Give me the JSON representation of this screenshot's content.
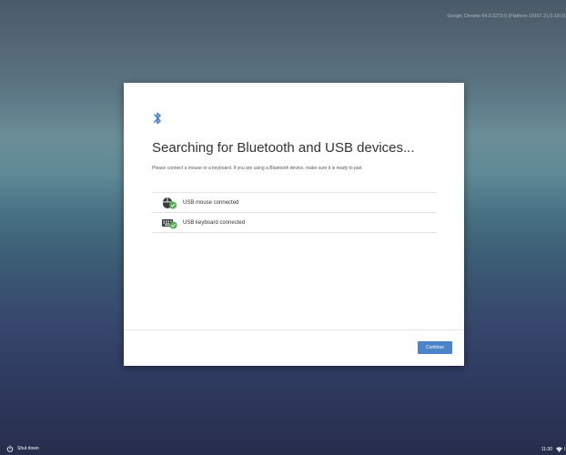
{
  "system": {
    "version": "Google Chrome 64.0.3273.0 (Platform 10167.21.0-18.01"
  },
  "dialog": {
    "icon": "bluetooth-icon",
    "title": "Searching for Bluetooth and USB devices...",
    "subtitle": "Please connect a mouse or a keyboard. If you are using a Bluetooth device, make sure it is ready to pair.",
    "devices": [
      {
        "label": "USB mouse connected",
        "icon": "mouse-icon",
        "status_icon": "check-circle-icon"
      },
      {
        "label": "USB keyboard connected",
        "icon": "keyboard-icon",
        "status_icon": "check-circle-icon"
      }
    ],
    "continue_label": "Continue",
    "accent_color": "#4b84c8",
    "check_color": "#4caf50"
  },
  "shelf": {
    "shutdown_label": "Shut down",
    "clock": "11:30",
    "status_tail": "l"
  }
}
